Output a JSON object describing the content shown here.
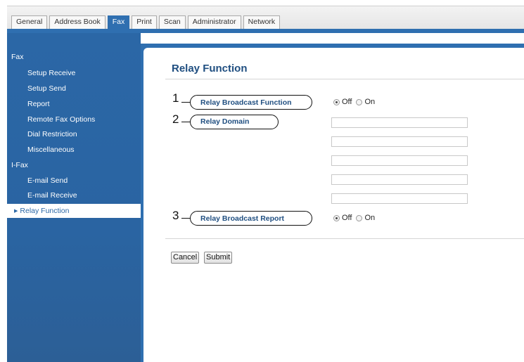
{
  "tabs": [
    {
      "label": "General",
      "active": false
    },
    {
      "label": "Address Book",
      "active": false
    },
    {
      "label": "Fax",
      "active": true
    },
    {
      "label": "Print",
      "active": false
    },
    {
      "label": "Scan",
      "active": false
    },
    {
      "label": "Administrator",
      "active": false
    },
    {
      "label": "Network",
      "active": false
    }
  ],
  "sidebar": {
    "fax_header": "Fax",
    "fax_items": [
      "Setup Receive",
      "Setup Send",
      "Report",
      "Remote Fax Options",
      "Dial Restriction",
      "Miscellaneous"
    ],
    "ifax_header": "I-Fax",
    "ifax_items": [
      "E-mail Send",
      "E-mail Receive"
    ],
    "active_item": "Relay Function"
  },
  "main": {
    "title": "Relay Function",
    "callouts": [
      "1",
      "2",
      "3"
    ],
    "relay_broadcast_function": {
      "label": "Relay Broadcast Function",
      "options": [
        "Off",
        "On"
      ],
      "selected": "Off"
    },
    "relay_domain": {
      "label": "Relay Domain",
      "values": [
        "",
        "",
        "",
        "",
        ""
      ]
    },
    "relay_broadcast_report": {
      "label": "Relay Broadcast Report",
      "options": [
        "Off",
        "On"
      ],
      "selected": "Off"
    },
    "buttons": {
      "cancel": "Cancel",
      "submit": "Submit"
    }
  },
  "colors": {
    "accent": "#2f6fb0",
    "label_text": "#1f4e80"
  }
}
